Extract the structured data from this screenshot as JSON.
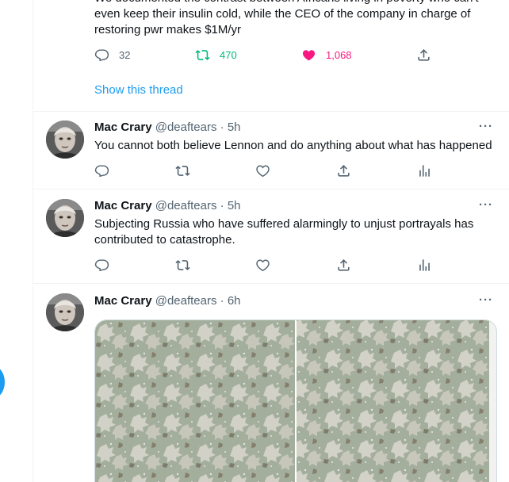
{
  "top_tweet": {
    "text_line_0": "We documented the contrast between Africans living in poverty who can't",
    "text_line_1": "even keep their insulin cold, while the CEO of the company in charge of",
    "text_line_2": "restoring pwr makes $1M/yr",
    "replies": "32",
    "retweets": "470",
    "likes": "1,068",
    "show_thread": "Show this thread"
  },
  "tweets": [
    {
      "name": "Mac Crary",
      "meta": "@deaftears · 5h",
      "text_lines": [
        "You cannot both believe Lennon and do anything about what has happened"
      ]
    },
    {
      "name": "Mac Crary",
      "meta": "@deaftears · 5h",
      "text_lines": [
        "Subjecting Russia who have suffered alarmingly to unjust portrayals has",
        "contributed to catastrophe."
      ]
    },
    {
      "name": "Mac Crary",
      "meta": "@deaftears · 6h",
      "text_lines": []
    }
  ],
  "more_glyph": "···",
  "colors": {
    "accent": "#1d9bf0",
    "retweet_green": "#00ba7c",
    "like_pink": "#f91880",
    "muted": "#536471"
  },
  "icons": [
    "reply-icon",
    "retweet-icon",
    "like-icon",
    "share-icon",
    "analytics-icon",
    "more-icon"
  ]
}
